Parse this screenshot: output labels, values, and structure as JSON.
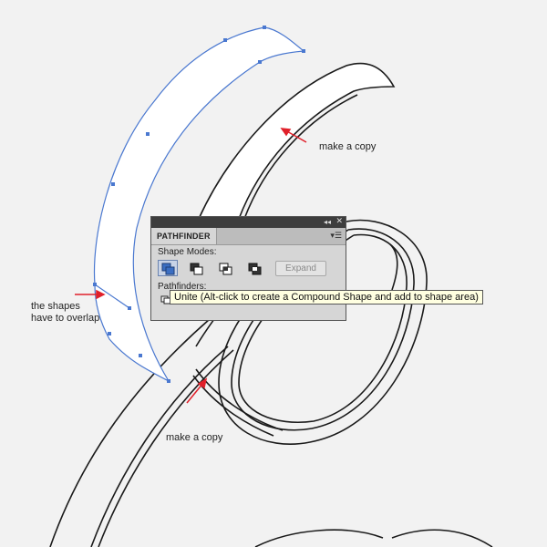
{
  "annotations": {
    "copy_top": "make a copy",
    "overlap": "the shapes\nhave to overlap",
    "copy_bottom": "make a copy"
  },
  "panel": {
    "title": "PATHFINDER",
    "shape_modes_label": "Shape Modes:",
    "pathfinders_label": "Pathfinders:",
    "expand_label": "Expand",
    "shape_modes": [
      {
        "name": "unite",
        "active": true
      },
      {
        "name": "minus-front",
        "active": false
      },
      {
        "name": "intersect",
        "active": false
      },
      {
        "name": "exclude",
        "active": false
      }
    ]
  },
  "tooltip": {
    "text": "Unite (Alt-click to create a Compound Shape and add to shape area)"
  },
  "colors": {
    "background": "#f2f2f2",
    "selection": "#4a78d0",
    "arrow": "#e0202a",
    "panel": "#d6d6d6",
    "titlebar": "#3d3d3d",
    "tooltip": "#ffffe1"
  }
}
